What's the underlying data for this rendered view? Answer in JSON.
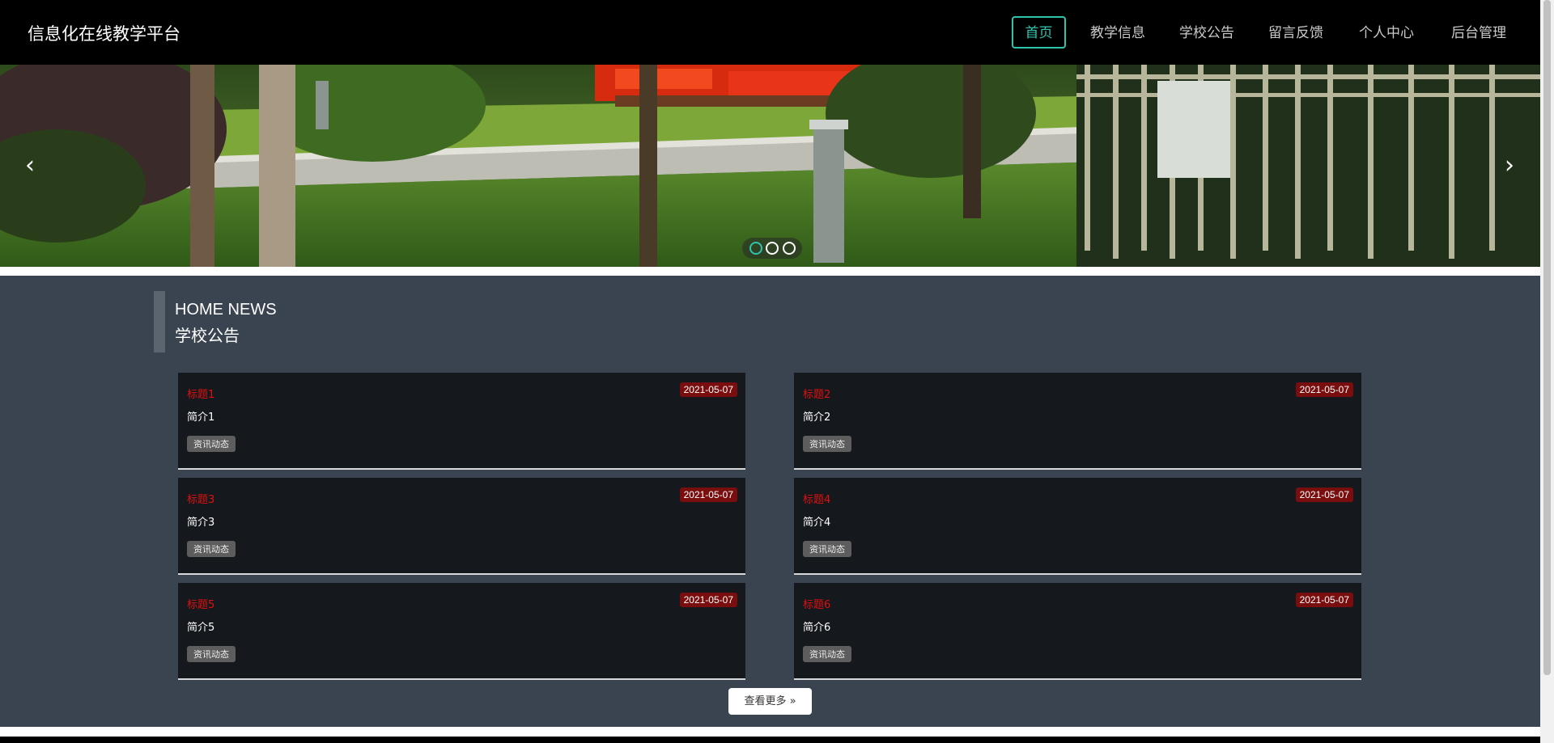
{
  "header": {
    "brand": "信息化在线教学平台",
    "nav": [
      {
        "label": "首页",
        "active": true
      },
      {
        "label": "教学信息",
        "active": false
      },
      {
        "label": "学校公告",
        "active": false
      },
      {
        "label": "留言反馈",
        "active": false
      },
      {
        "label": "个人中心",
        "active": false
      },
      {
        "label": "后台管理",
        "active": false
      }
    ]
  },
  "banner": {
    "prev_icon": "‹",
    "next_icon": "›",
    "slides": 3,
    "active_slide": 1
  },
  "news": {
    "title_en": "HOME NEWS",
    "title_cn": "学校公告",
    "items": [
      {
        "title": "标题1",
        "date": "2021-05-07",
        "desc": "简介1",
        "tag": "资讯动态"
      },
      {
        "title": "标题2",
        "date": "2021-05-07",
        "desc": "简介2",
        "tag": "资讯动态"
      },
      {
        "title": "标题3",
        "date": "2021-05-07",
        "desc": "简介3",
        "tag": "资讯动态"
      },
      {
        "title": "标题4",
        "date": "2021-05-07",
        "desc": "简介4",
        "tag": "资讯动态"
      },
      {
        "title": "标题5",
        "date": "2021-05-07",
        "desc": "简介5",
        "tag": "资讯动态"
      },
      {
        "title": "标题6",
        "date": "2021-05-07",
        "desc": "简介6",
        "tag": "资讯动态"
      }
    ],
    "more_label": "查看更多"
  },
  "colors": {
    "accent": "#2ec4b0",
    "header_bg": "#000000",
    "section_bg": "#3a4450",
    "card_bg": "#15181d",
    "title_red": "#e01010",
    "date_bg": "#7a0d0d"
  }
}
